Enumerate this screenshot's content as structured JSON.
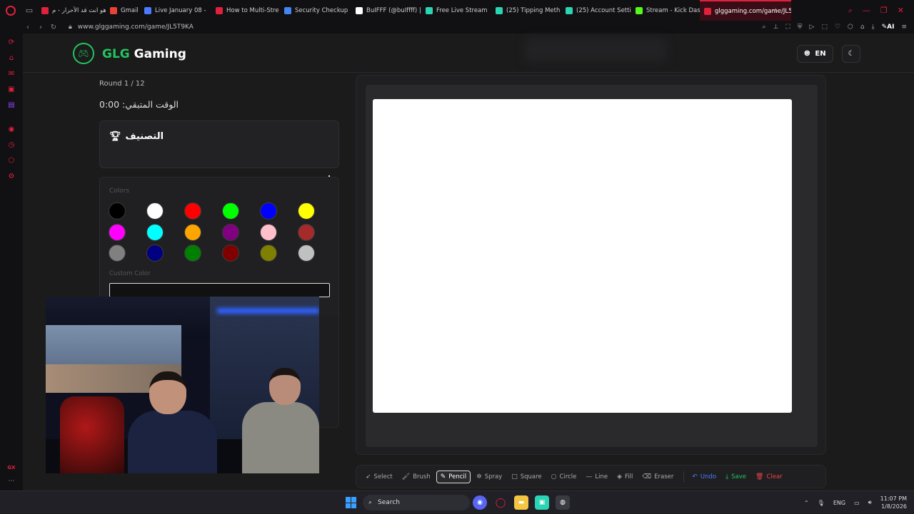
{
  "browser": {
    "tabs": [
      {
        "label": "هو انت قد الأحرار - م",
        "color": "#e0213c"
      },
      {
        "label": "Gmail",
        "color": "#ea4335"
      },
      {
        "label": "Live January 08 -",
        "color": "#4a7bff"
      },
      {
        "label": "How to Multi-Stre",
        "color": "#e0213c"
      },
      {
        "label": "Security Checkup",
        "color": "#4285f4"
      },
      {
        "label": "BuIFFF (@buIffff) |",
        "color": "#ffffff"
      },
      {
        "label": "Free Live Stream",
        "color": "#2bd5b4"
      },
      {
        "label": "(25) Tipping Meth",
        "color": "#2bd5b4"
      },
      {
        "label": "(25) Account Setti",
        "color": "#2bd5b4"
      },
      {
        "label": "Stream - Kick Das",
        "color": "#53fc18"
      },
      {
        "label": "glggaming.com/game/JL5",
        "color": "#e0213c"
      }
    ],
    "url": "www.glggaming.com/game/JL5T9KA",
    "ai_label": "AI"
  },
  "site": {
    "brand_highlight": "GLG",
    "brand_rest": " Gaming",
    "lang": "EN",
    "accent": "#22c55e"
  },
  "game": {
    "round": "Round 1 / 12",
    "timer": "الوقت المتبقي: 0:00",
    "ranking_title": "التصنيف",
    "colors_label": "Colors",
    "custom_color_label": "Custom Color",
    "swatches": [
      "#000000",
      "#ffffff",
      "#ff0000",
      "#00ff00",
      "#0000ff",
      "#ffff00",
      "#ff00ff",
      "#00ffff",
      "#ffa500",
      "#800080",
      "#ffc0cb",
      "#a52a2a",
      "#808080",
      "#000080",
      "#008000",
      "#800000",
      "#808000",
      "#c0c0c0"
    ]
  },
  "toolbar": {
    "select": "Select",
    "brush": "Brush",
    "pencil": "Pencil",
    "spray": "Spray",
    "square": "Square",
    "circle": "Circle",
    "line": "Line",
    "fill": "Fill",
    "eraser": "Eraser",
    "undo": "Undo",
    "save": "Save",
    "clear": "Clear"
  },
  "taskbar": {
    "search": "Search",
    "lang": "ENG",
    "time": "11:07 PM",
    "date": "1/8/2026"
  }
}
